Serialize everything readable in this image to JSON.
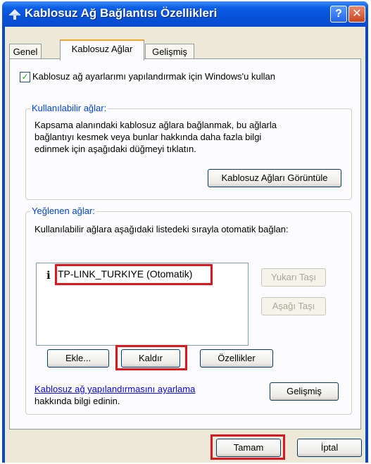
{
  "window": {
    "title": "Kablosuz Ağ Bağlantısı Özellikleri",
    "help_glyph": "?",
    "close_glyph": "✕"
  },
  "tabs": [
    {
      "label": "Genel"
    },
    {
      "label": "Kablosuz Ağlar",
      "active": true
    },
    {
      "label": "Gelişmiş"
    }
  ],
  "panel": {
    "use_windows_checkbox": {
      "label": "Kablosuz ağ ayarlarımı yapılandırmak için Windows'u kullan",
      "checked": true
    },
    "available": {
      "legend": "Kullanılabilir ağlar:",
      "lines": [
        "Kapsama alanındaki kablosuz ağlara bağlanmak, bu ağlarla",
        "bağlantıyı kesmek veya bunlar hakkında daha fazla bilgi",
        "edinmek için aşağıdaki düğmeyi tıklatın."
      ],
      "view_button": "Kablosuz Ağları Görüntüle"
    },
    "preferred": {
      "legend": "Yeğlenen ağlar:",
      "description": "Kullanılabilir ağlara aşağıdaki listedeki sırayla otomatik bağlan:",
      "networks": [
        {
          "name": "TP-LINK_TURKIYE (Otomatik)"
        }
      ],
      "move_up": "Yukarı Taşı",
      "move_down": "Aşağı Taşı",
      "add": "Ekle...",
      "remove": "Kaldır",
      "properties": "Özellikler"
    },
    "learn": {
      "link": "Kablosuz ağ yapılandırmasını ayarlama",
      "text": "hakkında bilgi edinin.",
      "advanced": "Gelişmiş"
    }
  },
  "footer": {
    "ok": "Tamam",
    "cancel": "İptal"
  },
  "colors": {
    "highlight": "#e0161e",
    "legend": "#0046d5"
  }
}
